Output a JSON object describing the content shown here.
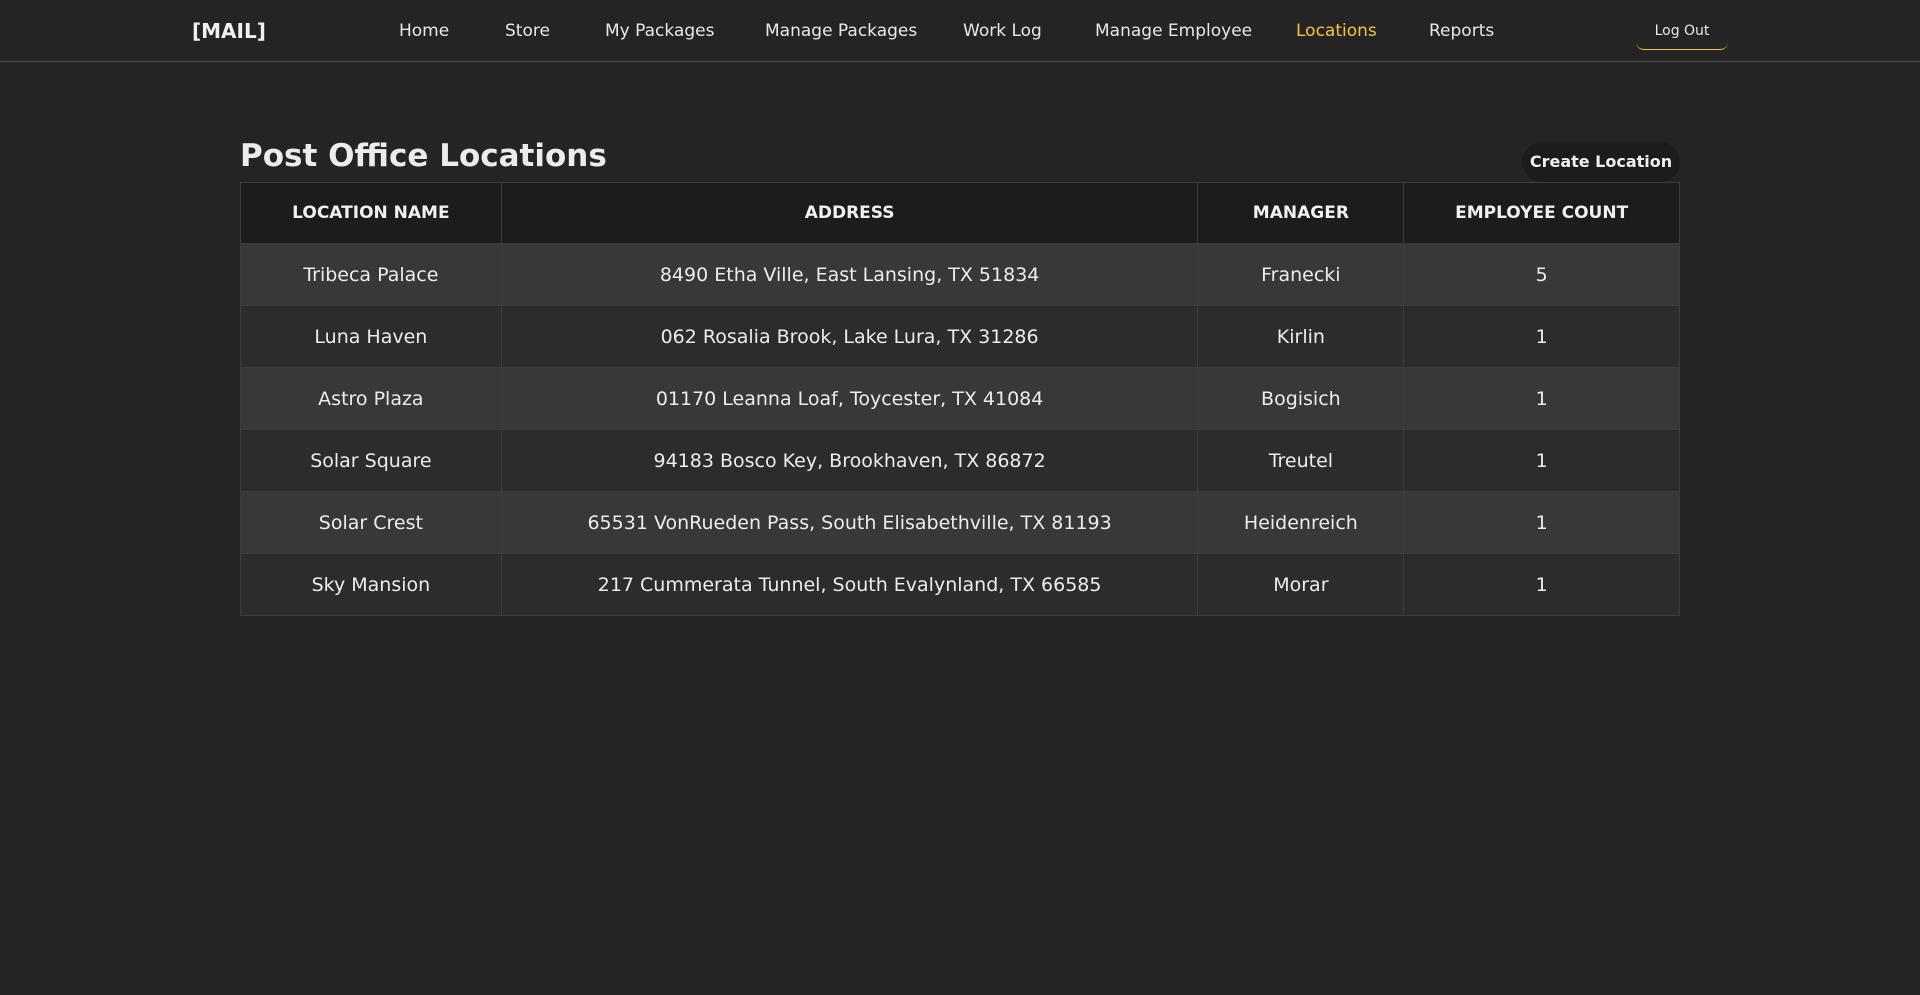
{
  "header": {
    "brand": "[MAIL]",
    "nav": [
      {
        "label": "Home",
        "active": false
      },
      {
        "label": "Store",
        "active": false
      },
      {
        "label": "My Packages",
        "active": false
      },
      {
        "label": "Manage Packages",
        "active": false
      },
      {
        "label": "Work Log",
        "active": false
      },
      {
        "label": "Manage Employee",
        "active": false
      },
      {
        "label": "Locations",
        "active": true
      },
      {
        "label": "Reports",
        "active": false
      }
    ],
    "logout_label": "Log Out"
  },
  "main": {
    "title": "Post Office Locations",
    "create_label": "Create Location",
    "table": {
      "columns": [
        "LOCATION NAME",
        "ADDRESS",
        "MANAGER",
        "EMPLOYEE COUNT"
      ],
      "rows": [
        [
          "Tribeca Palace",
          "8490 Etha Ville, East Lansing, TX 51834",
          "Franecki",
          "5"
        ],
        [
          "Luna Haven",
          "062 Rosalia Brook, Lake Lura, TX 31286",
          "Kirlin",
          "1"
        ],
        [
          "Astro Plaza",
          "01170 Leanna Loaf, Toycester, TX 41084",
          "Bogisich",
          "1"
        ],
        [
          "Solar Square",
          "94183 Bosco Key, Brookhaven, TX 86872",
          "Treutel",
          "1"
        ],
        [
          "Solar Crest",
          "65531 VonRueden Pass, South Elisabethville, TX 81193",
          "Heidenreich",
          "1"
        ],
        [
          "Sky Mansion",
          "217 Cummerata Tunnel, South Evalynland, TX 66585",
          "Morar",
          "1"
        ]
      ]
    }
  },
  "colors": {
    "background": "#242424",
    "accent": "#f4c542",
    "header_row": "#1c1c1c",
    "row_odd": "#383838",
    "row_even": "#2c2c2c"
  }
}
